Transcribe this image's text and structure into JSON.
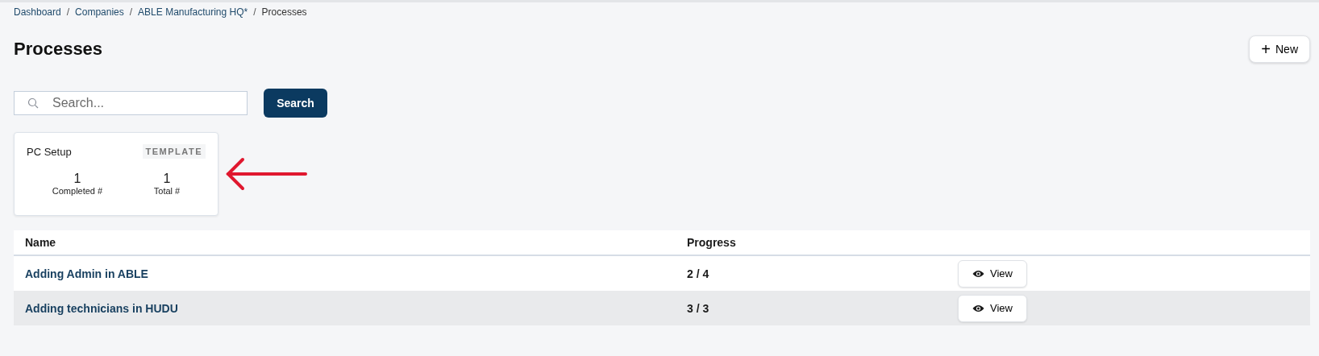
{
  "breadcrumb": [
    "Dashboard",
    "Companies",
    "ABLE Manufacturing HQ*",
    "Processes"
  ],
  "breadcrumb_separator": "/",
  "title": "Processes",
  "new_button": {
    "icon": "+",
    "label": "New"
  },
  "search": {
    "placeholder": "Search...",
    "button": "Search"
  },
  "cards": [
    {
      "name": "PC Setup",
      "badge": "TEMPLATE",
      "stats": [
        {
          "value": "1",
          "label": "Completed #"
        },
        {
          "value": "1",
          "label": "Total #"
        }
      ]
    }
  ],
  "table": {
    "columns": [
      "Name",
      "Progress"
    ],
    "rows": [
      {
        "name": "Adding Admin in ABLE",
        "progress": "2 / 4",
        "action": "View"
      },
      {
        "name": "Adding technicians in HUDU",
        "progress": "3 / 3",
        "action": "View"
      }
    ]
  }
}
